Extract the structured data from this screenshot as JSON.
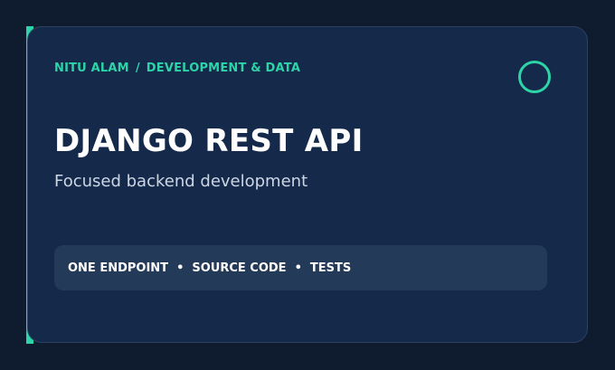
{
  "header": {
    "author": "NITU ALAM",
    "separator": "/",
    "category": "DEVELOPMENT & DATA"
  },
  "title": "DJANGO REST API",
  "subtitle": "Focused backend development",
  "features": {
    "items": [
      "ONE ENDPOINT",
      "SOURCE CODE",
      "TESTS"
    ],
    "separator": "•"
  },
  "icon": "ring-icon",
  "colors": {
    "background": "#0f1b2f",
    "card": "#15294a",
    "accent": "#2dd4a7",
    "pill": "#233a59"
  }
}
